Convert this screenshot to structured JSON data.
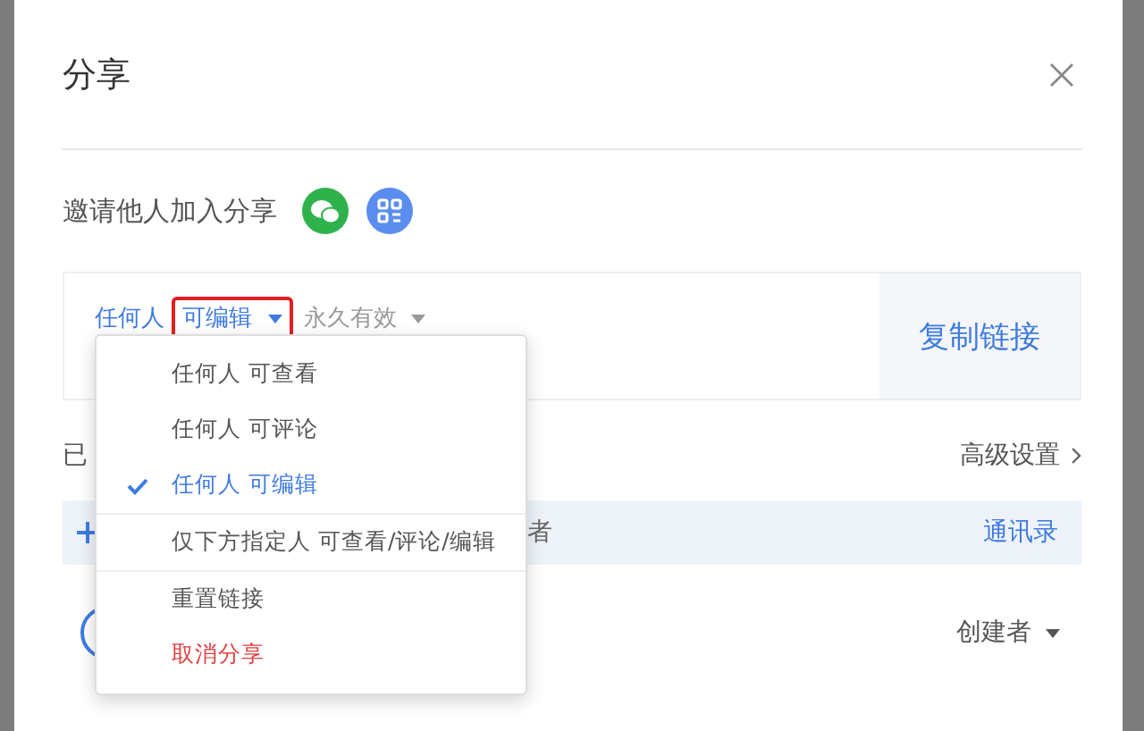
{
  "dialog": {
    "title": "分享"
  },
  "invite": {
    "label": "邀请他人加入分享"
  },
  "link": {
    "scope": "任何人",
    "permission": "可编辑",
    "highlighted": true,
    "expiry": "永久有效",
    "copy_button": "复制链接"
  },
  "members_section": {
    "heading": "已",
    "advanced": "高级设置"
  },
  "add_row": {
    "text": "者",
    "contacts": "通讯录"
  },
  "members": [
    {
      "role": "创建者"
    }
  ],
  "menu": {
    "groups": [
      [
        {
          "kind": "option",
          "label": "任何人 可查看",
          "selected": false
        },
        {
          "kind": "option",
          "label": "任何人 可评论",
          "selected": false
        },
        {
          "kind": "option",
          "label": "任何人 可编辑",
          "selected": true
        }
      ],
      [
        {
          "kind": "option",
          "label": "仅下方指定人 可查看/评论/编辑",
          "selected": false
        }
      ],
      [
        {
          "kind": "action",
          "label": "重置链接",
          "danger": false
        },
        {
          "kind": "action",
          "label": "取消分享",
          "danger": true
        }
      ]
    ]
  }
}
